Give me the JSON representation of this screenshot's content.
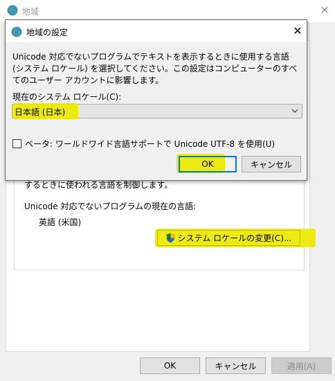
{
  "background_window": {
    "title": "地域",
    "partial_text": "するときに使われる言語を制御します。",
    "current_language_label": "Unicode 対応でないプログラムの現在の言語:",
    "current_language_value": "英語 (米国)",
    "change_locale_button": "システム ロケールの変更(C)...",
    "buttons": {
      "ok": "OK",
      "cancel": "キャンセル",
      "apply": "適用(A)"
    }
  },
  "dialog": {
    "title": "地域の設定",
    "description": "Unicode 対応でないプログラムでテキストを表示するときに使用する言語 (システム ロケール) を選択してください。この設定はコンピューターのすべてのユーザー アカウントに影響します。",
    "locale_label": "現在のシステム ロケール(C):",
    "locale_value": "日本語 (日本)",
    "beta_checkbox_label": "ベータ: ワールドワイド言語サポートで Unicode UTF-8 を使用(U)",
    "beta_checked": false,
    "ok_button": "OK",
    "cancel_button": "キャンセル"
  },
  "icons": {
    "globe": "globe-icon",
    "close": "close-icon",
    "chevron": "chevron-down-icon",
    "shield": "uac-shield-icon"
  },
  "colors": {
    "highlight": "#eaea00",
    "focus_border": "#0078d7",
    "button_face": "#e1e1e1"
  }
}
